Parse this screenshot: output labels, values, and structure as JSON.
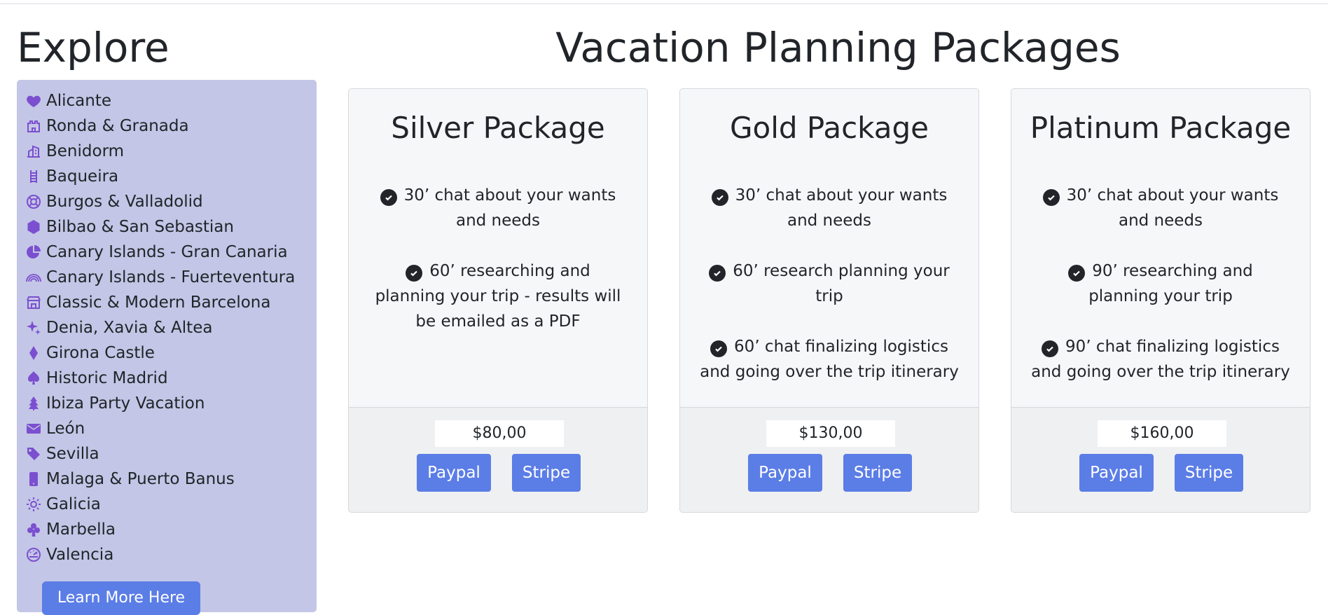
{
  "sidebar": {
    "title": "Explore",
    "items": [
      {
        "label": "Alicante",
        "icon": "heart-icon"
      },
      {
        "label": "Ronda & Granada",
        "icon": "castle-icon"
      },
      {
        "label": "Benidorm",
        "icon": "buildings-icon"
      },
      {
        "label": "Baqueira",
        "icon": "ladder-icon"
      },
      {
        "label": "Burgos & Valladolid",
        "icon": "life-ring-icon"
      },
      {
        "label": "Bilbao & San Sebastian",
        "icon": "hexagon-icon"
      },
      {
        "label": "Canary Islands - Gran Canaria",
        "icon": "pie-chart-icon"
      },
      {
        "label": "Canary Islands - Fuerteventura",
        "icon": "rainbow-icon"
      },
      {
        "label": "Classic & Modern Barcelona",
        "icon": "shop-icon"
      },
      {
        "label": "Denia, Xavia & Altea",
        "icon": "sparkles-icon"
      },
      {
        "label": "Girona Castle",
        "icon": "diamond-icon"
      },
      {
        "label": "Historic Madrid",
        "icon": "spade-icon"
      },
      {
        "label": "Ibiza Party Vacation",
        "icon": "tree-icon"
      },
      {
        "label": "León",
        "icon": "envelope-icon"
      },
      {
        "label": "Sevilla",
        "icon": "tags-icon"
      },
      {
        "label": "Malaga & Puerto Banus",
        "icon": "phone-icon"
      },
      {
        "label": "Galicia",
        "icon": "sun-icon"
      },
      {
        "label": "Marbella",
        "icon": "club-icon"
      },
      {
        "label": "Valencia",
        "icon": "speedometer-icon"
      }
    ],
    "learn_more_label": "Learn More Here"
  },
  "main": {
    "title": "Vacation Planning Packages",
    "packages": [
      {
        "title": "Silver Package",
        "features": [
          "30’ chat about your wants and needs",
          "60’ researching and planning your trip - results will be emailed as a PDF"
        ],
        "price": "$80,00",
        "paypal_label": "Paypal",
        "stripe_label": "Stripe"
      },
      {
        "title": "Gold Package",
        "features": [
          "30’ chat about your wants and needs",
          "60’ research planning your trip",
          "60’ chat finalizing logistics and going over the trip itinerary"
        ],
        "price": "$130,00",
        "paypal_label": "Paypal",
        "stripe_label": "Stripe"
      },
      {
        "title": "Platinum Package",
        "features": [
          "30’ chat about your wants and needs",
          "90’ researching and planning your trip",
          "90’ chat finalizing logistics and going over the trip itinerary"
        ],
        "price": "$160,00",
        "paypal_label": "Paypal",
        "stripe_label": "Stripe"
      }
    ]
  },
  "colors": {
    "sidebar_background": "#c3c6e6",
    "icon_accent": "#7b4fd0",
    "button_primary": "#5b7de6",
    "card_background": "#f6f7f9",
    "card_footer": "#eff0f2",
    "text": "#212529"
  }
}
